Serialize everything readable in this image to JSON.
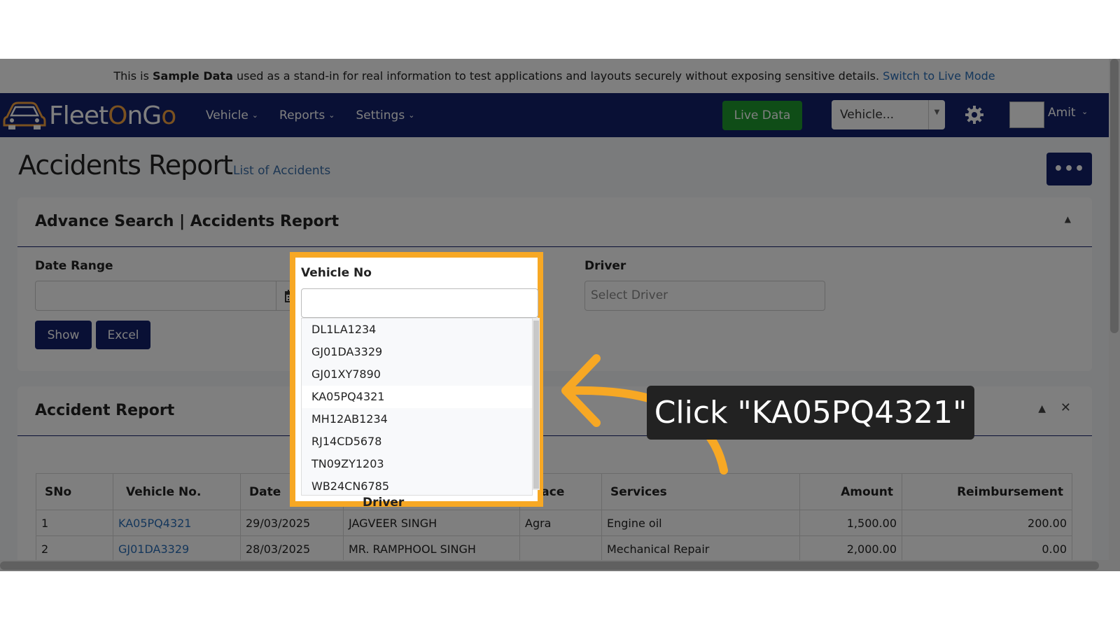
{
  "banner": {
    "prefix": "This is ",
    "bold": "Sample Data",
    "text": " used as a stand-in for real information to test applications and layouts securely without exposing sensitive details. ",
    "link": "Switch to Live Mode"
  },
  "navbar": {
    "logo_part1": "Fleet",
    "logo_part2": "O",
    "logo_part3": "nG",
    "logo_part4": "o",
    "menu": [
      "Vehicle",
      "Reports",
      "Settings"
    ],
    "live_button": "Live Data",
    "vehicle_select": "Vehicle...",
    "user_name": "Amit"
  },
  "page": {
    "title": "Accidents Report",
    "subtitle": "List of Accidents",
    "more_button": "•••"
  },
  "search_card": {
    "title": "Advance Search | Accidents Report",
    "date_range_label": "Date Range",
    "vehicle_label": "Vehicle No",
    "driver_label": "Driver",
    "driver_placeholder": "Select Driver",
    "show_button": "Show",
    "excel_button": "Excel"
  },
  "vehicle_options": [
    "DL1LA1234",
    "GJ01DA3329",
    "GJ01XY7890",
    "KA05PQ4321",
    "MH12AB1234",
    "RJ14CD5678",
    "TN09ZY1203",
    "WB24CN6785"
  ],
  "report_card": {
    "title": "Accident Report",
    "columns": [
      "SNo",
      "Vehicle No.",
      "Date",
      "Driver",
      "Place",
      "Services",
      "Amount",
      "Reimbursement"
    ],
    "rows": [
      {
        "sno": "1",
        "vehicle": "KA05PQ4321",
        "date": "29/03/2025",
        "driver": "JAGVEER SINGH",
        "place": "Agra",
        "services": "Engine oil",
        "amount": "1,500.00",
        "reimb": "200.00"
      },
      {
        "sno": "2",
        "vehicle": "GJ01DA3329",
        "date": "28/03/2025",
        "driver": "MR. RAMPHOOL SINGH",
        "place": "",
        "services": "Mechanical Repair",
        "amount": "2,000.00",
        "reimb": "0.00"
      }
    ]
  },
  "callout": {
    "text": "Click \"KA05PQ4321\""
  },
  "colors": {
    "navbar": "#12206b",
    "accent": "#f7a824",
    "live": "#1e9b2e",
    "link": "#2a6fb8"
  },
  "icons": [
    "calendar-icon",
    "gear-icon",
    "chevron-down-icon",
    "chevron-up-icon",
    "close-icon",
    "car-logo-icon"
  ]
}
